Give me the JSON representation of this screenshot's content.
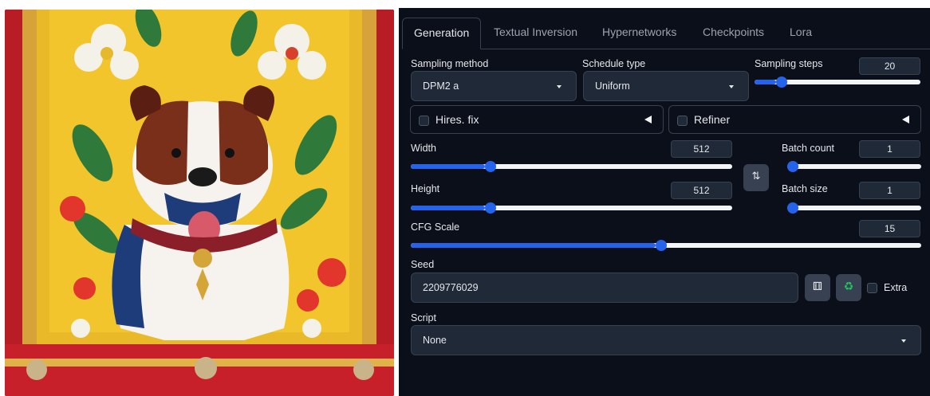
{
  "image": {
    "subject": "bulldog-embroidery-artwork"
  },
  "tabs": [
    {
      "label": "Generation",
      "active": true
    },
    {
      "label": "Textual Inversion"
    },
    {
      "label": "Hypernetworks"
    },
    {
      "label": "Checkpoints"
    },
    {
      "label": "Lora"
    }
  ],
  "sampling_method": {
    "label": "Sampling method",
    "value": "DPM2 a"
  },
  "schedule_type": {
    "label": "Schedule type",
    "value": "Uniform"
  },
  "sampling_steps": {
    "label": "Sampling steps",
    "value": "20",
    "fraction": 0.13
  },
  "hires_fix": {
    "label": "Hires. fix",
    "checked": false
  },
  "refiner": {
    "label": "Refiner",
    "checked": false
  },
  "width": {
    "label": "Width",
    "value": "512",
    "fraction": 0.23
  },
  "height": {
    "label": "Height",
    "value": "512",
    "fraction": 0.23
  },
  "batch_count": {
    "label": "Batch count",
    "value": "1",
    "fraction": 0.0
  },
  "batch_size": {
    "label": "Batch size",
    "value": "1",
    "fraction": 0.0
  },
  "swap_icon": "swap-vertical-icon",
  "cfg_scale": {
    "label": "CFG Scale",
    "value": "15",
    "fraction": 0.48
  },
  "seed": {
    "label": "Seed",
    "value": "2209776029"
  },
  "seed_buttons": {
    "random_icon": "dice-icon",
    "reuse_icon": "recycle-icon"
  },
  "extra": {
    "label": "Extra",
    "checked": false
  },
  "script": {
    "label": "Script",
    "value": "None"
  },
  "colors": {
    "panel_bg": "#0b0f19",
    "accent": "#2563eb",
    "input_bg": "#1f2937",
    "border": "#374151"
  }
}
